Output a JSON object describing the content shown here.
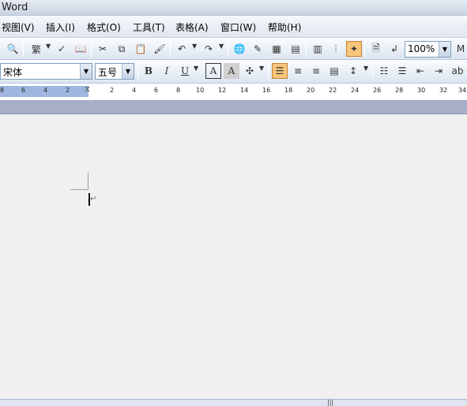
{
  "window": {
    "title": "Word"
  },
  "menubar": {
    "items": [
      {
        "name": "view",
        "label": "视图(V)"
      },
      {
        "name": "insert",
        "label": "插入(I)"
      },
      {
        "name": "format",
        "label": "格式(O)"
      },
      {
        "name": "tools",
        "label": "工具(T)"
      },
      {
        "name": "table",
        "label": "表格(A)"
      },
      {
        "name": "window",
        "label": "窗口(W)"
      },
      {
        "name": "help",
        "label": "帮助(H)"
      }
    ]
  },
  "toolbar": {
    "zoom": "100%",
    "standard_icons": [
      "print-preview-icon",
      "spelling-icon",
      "research-icon",
      "cut-icon",
      "copy-icon",
      "paste-icon",
      "format-painter-icon",
      "undo-icon",
      "redo-icon",
      "hyperlink-icon",
      "tables-borders-icon",
      "insert-table-icon",
      "insert-excel-icon",
      "columns-icon",
      "drawing-icon",
      "show-hide-icon",
      "document-map-icon",
      "read-icon"
    ]
  },
  "formatting": {
    "font": "宋体",
    "size": "五号",
    "bold": "B",
    "italic": "I",
    "underline": "U",
    "char_border": "A",
    "char_shading": "A"
  },
  "ruler": {
    "ticks": [
      "8",
      "6",
      "4",
      "2",
      "2",
      "4",
      "6",
      "8",
      "10",
      "12",
      "14",
      "16",
      "18",
      "20",
      "22",
      "24",
      "26",
      "28",
      "30",
      "32",
      "34"
    ]
  },
  "document": {
    "paragraph_mark": "↵"
  },
  "status": {
    "grip": "|||"
  }
}
